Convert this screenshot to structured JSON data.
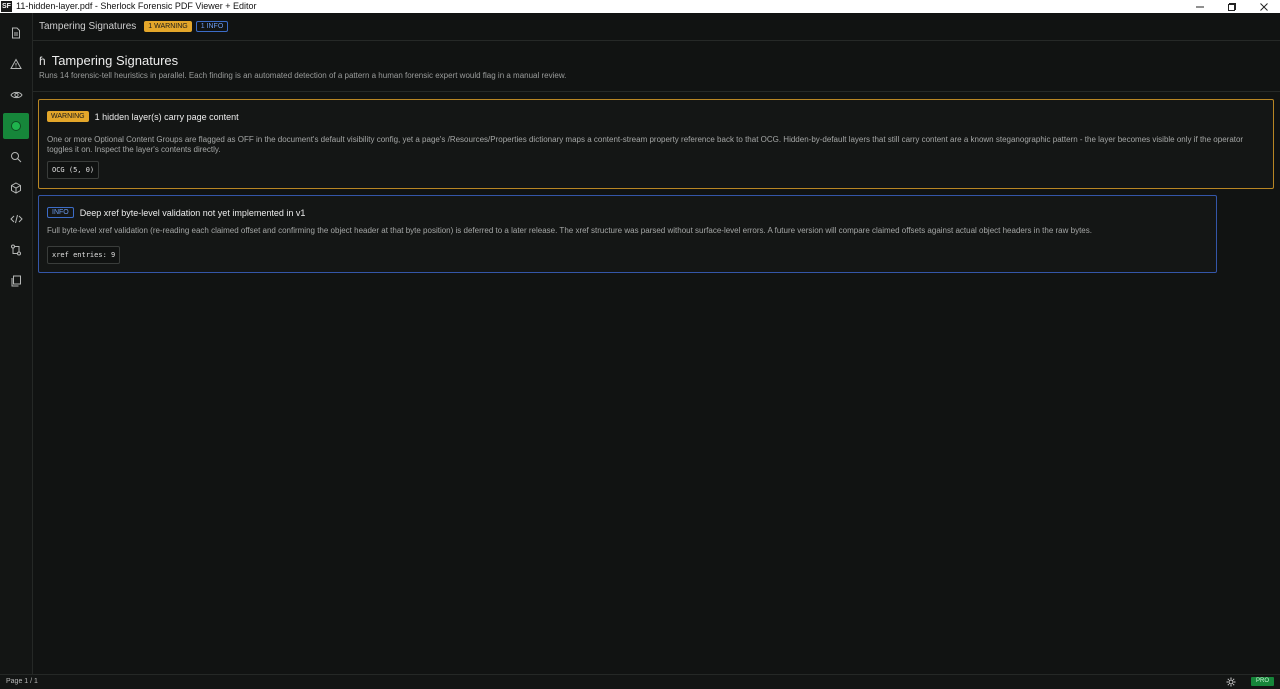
{
  "window": {
    "logo": "SF",
    "title": "11-hidden-layer.pdf - Sherlock Forensic PDF Viewer + Editor",
    "controls": [
      "minimize-icon",
      "maximize-icon",
      "close-icon"
    ]
  },
  "rail": {
    "items": [
      {
        "name": "document-icon"
      },
      {
        "name": "warning-icon"
      },
      {
        "name": "eye-icon"
      },
      {
        "name": "circle-icon",
        "active": true
      },
      {
        "name": "search-icon"
      },
      {
        "name": "cube-icon"
      },
      {
        "name": "code-icon"
      },
      {
        "name": "branch-icon"
      },
      {
        "name": "copy-icon"
      }
    ]
  },
  "header": {
    "breadcrumb": "Tampering Signatures",
    "warning_badge": "1 WARNING",
    "info_badge": "1 INFO"
  },
  "page": {
    "heading_icon": "ɦ",
    "title": "Tampering Signatures",
    "description": "Runs 14 forensic-tell heuristics in parallel. Each finding is an automated detection of a pattern a human forensic expert would flag in a manual review."
  },
  "findings": [
    {
      "severity": "WARNING",
      "title": "1 hidden layer(s) carry page content",
      "body": "One or more Optional Content Groups are flagged as OFF in the document's default visibility config, yet a page's /Resources/Properties dictionary maps a content-stream property reference back to that OCG. Hidden-by-default layers that still carry content are a known steganographic pattern - the layer becomes visible only if the operator toggles it on. Inspect the layer's contents directly.",
      "evidence": "OCG (5, 0)"
    },
    {
      "severity": "INFO",
      "title": "Deep xref byte-level validation not yet implemented in v1",
      "body": "Full byte-level xref validation (re-reading each claimed offset and confirming the object header at that byte position) is deferred to a later release. The xref structure was parsed without surface-level errors. A future version will compare claimed offsets against actual object headers in the raw bytes.",
      "evidence": "xref entries: 9"
    }
  ],
  "status": {
    "page_indicator": "Page 1 / 1",
    "theme_icon": "sun-icon",
    "plan_badge": "PRO"
  },
  "colors": {
    "background": "#111312",
    "warning": "#e3a62a",
    "info": "#3c6cc7",
    "accent_green": "#16863a"
  }
}
